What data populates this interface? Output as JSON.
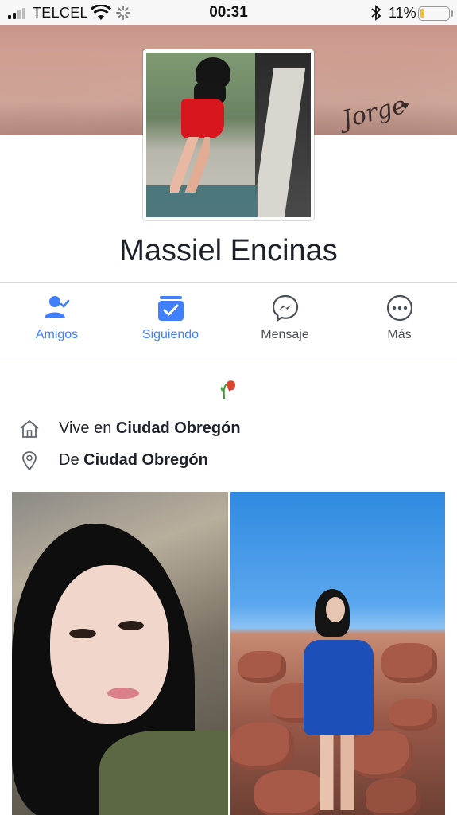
{
  "status_bar": {
    "carrier": "TELCEL",
    "time": "00:31",
    "battery_percent": "11%",
    "battery_level": 0.11,
    "battery_color": "#f2c232"
  },
  "cover": {
    "tattoo_text": "Jorge"
  },
  "profile": {
    "name": "Massiel Encinas"
  },
  "actions": [
    {
      "label": "Amigos",
      "icon": "friends-icon",
      "active": true
    },
    {
      "label": "Siguiendo",
      "icon": "following-icon",
      "active": true
    },
    {
      "label": "Mensaje",
      "icon": "messenger-icon",
      "active": false
    },
    {
      "label": "Más",
      "icon": "more-icon",
      "active": false
    }
  ],
  "intro": {
    "emoji_icon": "wilted-flower-emoji",
    "lives_in": {
      "prefix": "Vive en",
      "place": "Ciudad Obregón",
      "icon": "home-icon"
    },
    "from": {
      "prefix": "De",
      "place": "Ciudad Obregón",
      "icon": "location-pin-icon"
    }
  },
  "colors": {
    "accent_blue": "#4080ff",
    "text_dark": "#1d2129",
    "text_grey": "#4b4f56",
    "divider": "#dadde1"
  },
  "photos": [
    {
      "kind": "selfie"
    },
    {
      "kind": "beach-rocks"
    }
  ]
}
